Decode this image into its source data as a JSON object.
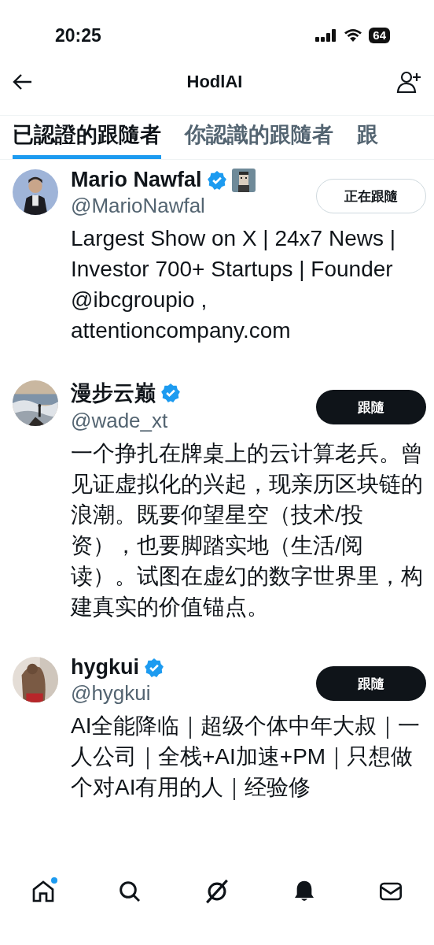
{
  "status_bar": {
    "time": "20:25",
    "battery": "64"
  },
  "header": {
    "title": "HodlAI"
  },
  "tabs": [
    {
      "label": "已認證的跟隨者",
      "selected": true
    },
    {
      "label": "你認識的跟隨者",
      "selected": false
    },
    {
      "label": "跟",
      "selected": false
    }
  ],
  "users": [
    {
      "name": "Mario Nawfal",
      "verified": true,
      "extra_badge": true,
      "handle": "@MarioNawfal",
      "button": "正在跟隨",
      "following": true,
      "bio": "Largest Show on X | 24x7 News | Investor 700+ Startups | Founder @ibcgroupio , attentioncompany.com"
    },
    {
      "name": "漫步云巅",
      "verified": true,
      "extra_badge": false,
      "handle": "@wade_xt",
      "button": "跟隨",
      "following": false,
      "bio": "一个挣扎在牌桌上的云计算老兵。曾见证虚拟化的兴起，现亲历区块链的浪潮。既要仰望星空（技术/投资），也要脚踏实地（生活/阅读）。试图在虚幻的数字世界里，构建真实的价值锚点。"
    },
    {
      "name": "hygkui",
      "verified": true,
      "extra_badge": false,
      "handle": "@hygkui",
      "button": "跟隨",
      "following": false,
      "bio": "AI全能降临｜超级个体中年大叔｜一人公司｜全栈+AI加速+PM｜只想做个对AI有用的人｜经验修"
    }
  ],
  "nav": [
    {
      "kind": "home",
      "dot": true
    },
    {
      "kind": "search",
      "dot": false
    },
    {
      "kind": "grok",
      "dot": false
    },
    {
      "kind": "bell",
      "dot": false
    },
    {
      "kind": "mail",
      "dot": false
    }
  ]
}
